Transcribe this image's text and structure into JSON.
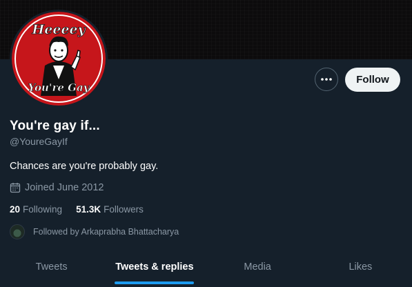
{
  "profile": {
    "name": "You're gay if...",
    "handle": "@YoureGayIf",
    "bio": "Chances are you're probably gay.",
    "joined": "Joined June 2012",
    "avatar_text_top": "Heeeey",
    "avatar_text_bottom": "You're Gay"
  },
  "buttons": {
    "follow_label": "Follow",
    "more_icon": "more-horizontal-icon"
  },
  "stats": {
    "following_count": "20",
    "following_label": "Following",
    "followers_count": "51.3K",
    "followers_label": "Followers"
  },
  "followed_by": "Followed by Arkaprabha Bhattacharya",
  "tabs": [
    {
      "label": "Tweets",
      "active": false
    },
    {
      "label": "Tweets & replies",
      "active": true
    },
    {
      "label": "Media",
      "active": false
    },
    {
      "label": "Likes",
      "active": false
    }
  ],
  "colors": {
    "background": "#15202b",
    "accent": "#1d9bf0",
    "muted_text": "#8b98a5"
  }
}
